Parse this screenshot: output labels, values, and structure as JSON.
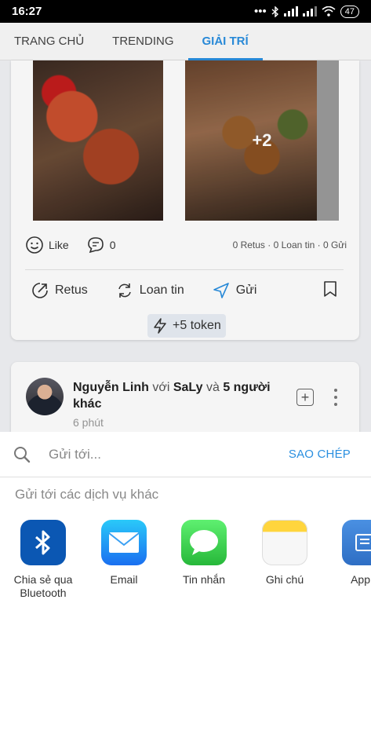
{
  "status_bar": {
    "time": "16:27",
    "battery": "47"
  },
  "tabs": [
    {
      "label": "TRANG CHỦ",
      "active": false
    },
    {
      "label": "TRENDING",
      "active": false
    },
    {
      "label": "GIẢI TRÍ",
      "active": true
    }
  ],
  "post1": {
    "more_photos": "+2",
    "like_label": "Like",
    "comment_count": "0",
    "summary": "0 Retus · 0 Loan tin · 0 Gửi",
    "actions": {
      "retus": "Retus",
      "loan_tin": "Loan tin",
      "gui": "Gửi"
    },
    "token": "+5 token"
  },
  "post2": {
    "author": "Nguyễn Linh",
    "with_word": "với",
    "tagged": "SaLy",
    "and_word": "và",
    "others": "5 người khác",
    "time": "6 phút"
  },
  "share_sheet": {
    "search_placeholder": "Gửi tới...",
    "copy_label": "SAO CHÉP",
    "section_title": "Gửi tới các dịch vụ khác",
    "apps": [
      {
        "label": "Chia sẻ qua\nBluetooth",
        "icon": "bluetooth-icon"
      },
      {
        "label": "Email",
        "icon": "mail-icon"
      },
      {
        "label": "Tin nhắn",
        "icon": "message-icon"
      },
      {
        "label": "Ghi chú",
        "icon": "notes-icon"
      },
      {
        "label": "App v",
        "icon": "app-icon"
      }
    ]
  },
  "colors": {
    "accent": "#2a8fe0"
  }
}
